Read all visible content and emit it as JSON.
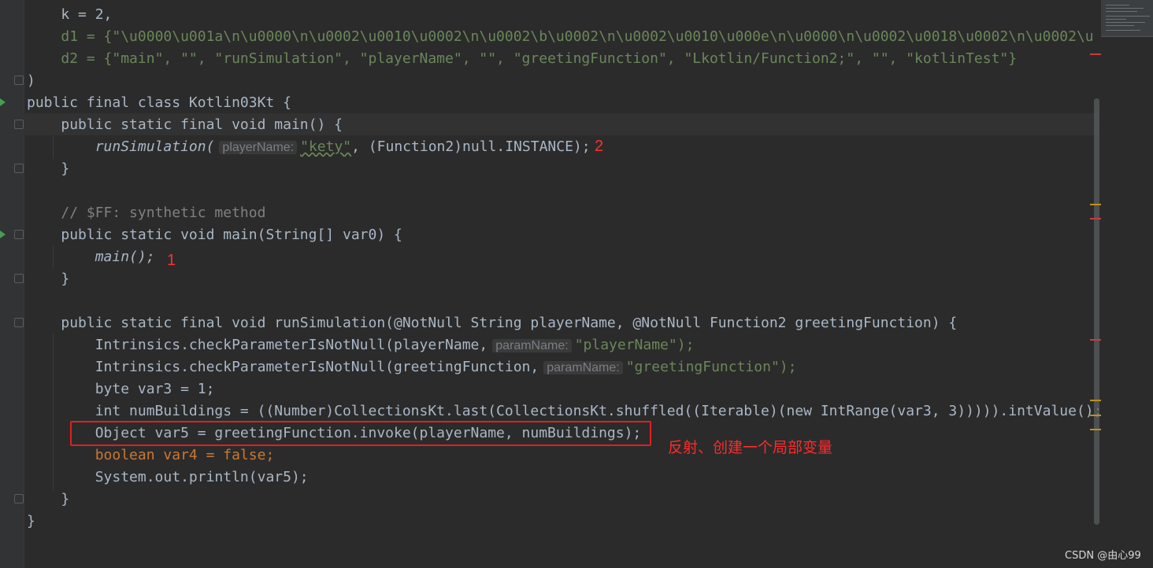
{
  "code": {
    "k_line": "k = 2,",
    "d1_line": "d1 = {\"\\u0000\\u001a\\n\\u0000\\n\\u0002\\u0010\\u0002\\n\\u0002\\b\\u0002\\n\\u0002\\u0010\\u000e\\n\\u0000\\n\\u0002\\u0018\\u0002\\n\\u0002\\u",
    "d2_line": "d2 = {\"main\", \"\", \"runSimulation\", \"playerName\", \"\", \"greetingFunction\", \"Lkotlin/Function2;\", \"\", \"kotlinTest\"}",
    "close_paren": ")",
    "class_decl": "public final class Kotlin03Kt {",
    "main_decl": "public static final void main() {",
    "run_call": "runSimulation(",
    "hint_playerName": "playerName:",
    "kety": "\"kety\"",
    "cast_rest": ", (Function2)null.INSTANCE);",
    "close1": "}",
    "comment": "// $FF: synthetic method",
    "main2_decl": "public static void main(String[] var0) {",
    "main_call": "main();",
    "close2": "}",
    "runsim_decl": "public static final void runSimulation(@NotNull String playerName, @NotNull Function2 greetingFunction) {",
    "check1_pre": "Intrinsics.checkParameterIsNotNull(playerName,",
    "hint_paramName": "paramName:",
    "check1_arg": "\"playerName\");",
    "check2_pre": "Intrinsics.checkParameterIsNotNull(greetingFunction,",
    "check2_arg": "\"greetingFunction\");",
    "byte_line": "byte var3 = 1;",
    "int_line": "int numBuildings = ((Number)CollectionsKt.last(CollectionsKt.shuffled((Iterable)(new IntRange(var3, 3))))).intValue();",
    "object_line": "Object var5 = greetingFunction.invoke(playerName, numBuildings);",
    "bool_line": "boolean var4 = false;",
    "println_line": "System.out.println(var5);",
    "close3": "}",
    "close4": "}"
  },
  "annotations": {
    "num1": "1",
    "num2": "2",
    "note": "反射、创建一个局部变量"
  },
  "watermark": "CSDN @由心99",
  "colors": {
    "background": "#2b2b2b",
    "keyword": "#cc7832",
    "string": "#6a8759",
    "number": "#6897bb",
    "annotation_red": "#ff3030"
  }
}
